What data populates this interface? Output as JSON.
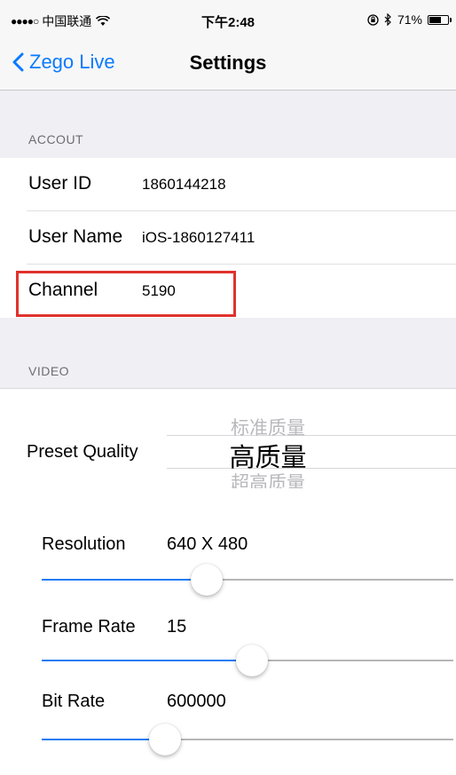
{
  "status_bar": {
    "signal": "●●●●○",
    "carrier": "中国联通",
    "time": "下午2:48",
    "battery": "71%",
    "battery_level": 0.71
  },
  "nav": {
    "back_label": "Zego Live",
    "title": "Settings"
  },
  "account": {
    "header": "ACCOUT",
    "rows": [
      {
        "label": "User ID",
        "value": "1860144218"
      },
      {
        "label": "User Name",
        "value": "iOS-1860127411"
      },
      {
        "label": "Channel",
        "value": "5190"
      }
    ]
  },
  "video": {
    "header": "VIDEO",
    "preset": {
      "label": "Preset Quality",
      "options_above": "标准质量",
      "selected": "高质量",
      "options_below": "超高质量"
    },
    "sliders": [
      {
        "label": "Resolution",
        "value": "640 X 480",
        "level": 0.4
      },
      {
        "label": "Frame Rate",
        "value": "15",
        "level": 0.51
      },
      {
        "label": "Bit Rate",
        "value": "600000",
        "level": 0.3
      }
    ]
  },
  "colors": {
    "accent": "#0a7aff",
    "slider_fill": "#1e7cf2",
    "highlight": "#e0322d",
    "group_bg": "#efeff4"
  }
}
